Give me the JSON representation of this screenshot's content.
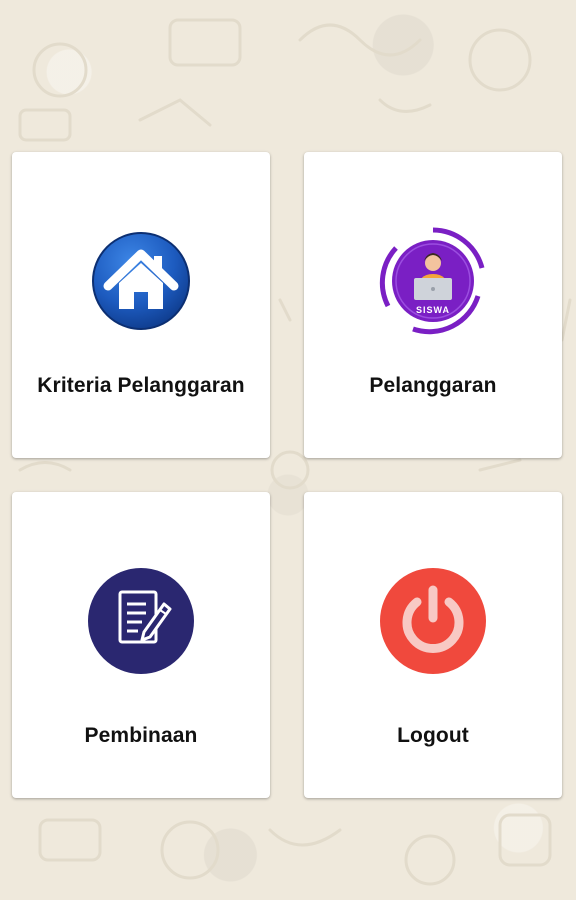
{
  "menu": {
    "items": [
      {
        "label": "Kriteria Pelanggaran",
        "icon": "home-icon",
        "color": "#1d5bbf"
      },
      {
        "label": "Pelanggaran",
        "icon": "student-icon",
        "color": "#7a1fc4",
        "badge_text": "SISWA"
      },
      {
        "label": "Pembinaan",
        "icon": "document-edit-icon",
        "color": "#2a2770"
      },
      {
        "label": "Logout",
        "icon": "power-icon",
        "color": "#f0493d"
      }
    ]
  }
}
